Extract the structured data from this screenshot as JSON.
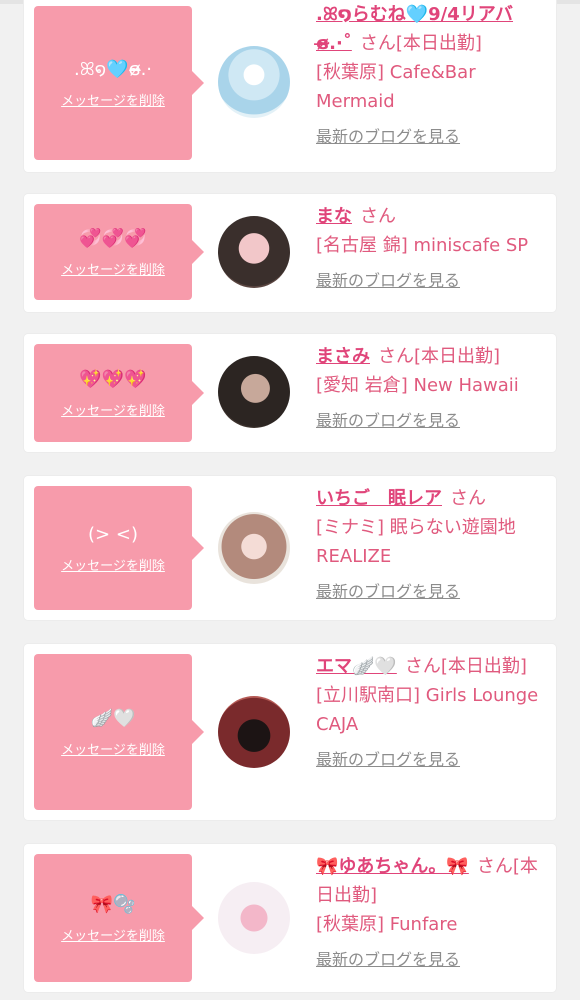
{
  "delete_label": "メッセージを削除",
  "blog_label": "最新のブログを見る",
  "honorific": "さん",
  "cards": [
    {
      "message": ".ꕤ໑🩵ɞ̴̶̷.·",
      "name": ".ꕤ໑らむね🩵9/4リアバɞ̴̶̷.·˚",
      "status": "[本日出勤]",
      "shop": "[秋葉原] Cafe&Bar Mermaid",
      "avatar_colors": [
        "#cfe8f4",
        "#a9d4ea"
      ]
    },
    {
      "message": "💞💞💞",
      "name": "まな",
      "status": "",
      "shop": "[名古屋 錦] miniscafe SP",
      "avatar_colors": [
        "#3a2f2c",
        "#f2c7c9"
      ]
    },
    {
      "message": "💖💖💖",
      "name": "まさみ",
      "status": "[本日出勤]",
      "shop": "[愛知 岩倉] New Hawaii",
      "avatar_colors": [
        "#2c2522",
        "#c7a89a"
      ]
    },
    {
      "message": "(> <)",
      "name": "いちご　眠レア",
      "status": "",
      "shop": "[ミナミ] 眠らない遊園地 REALIZE",
      "avatar_colors": [
        "#f4dcd6",
        "#b38a7c"
      ]
    },
    {
      "message": "🪽🤍",
      "name": "エマ🪽🤍",
      "status": "[本日出勤]",
      "shop": "[立川駅南口] Girls Lounge CAJA",
      "avatar_colors": [
        "#7a2a2c",
        "#1c1414"
      ]
    },
    {
      "message": "🎀🫧",
      "name": "🎀ゆあちゃん。🎀",
      "status": "[本日出勤]",
      "shop": "[秋葉原] Funfare",
      "avatar_colors": [
        "#f6eef3",
        "#f3b7c9"
      ]
    }
  ]
}
